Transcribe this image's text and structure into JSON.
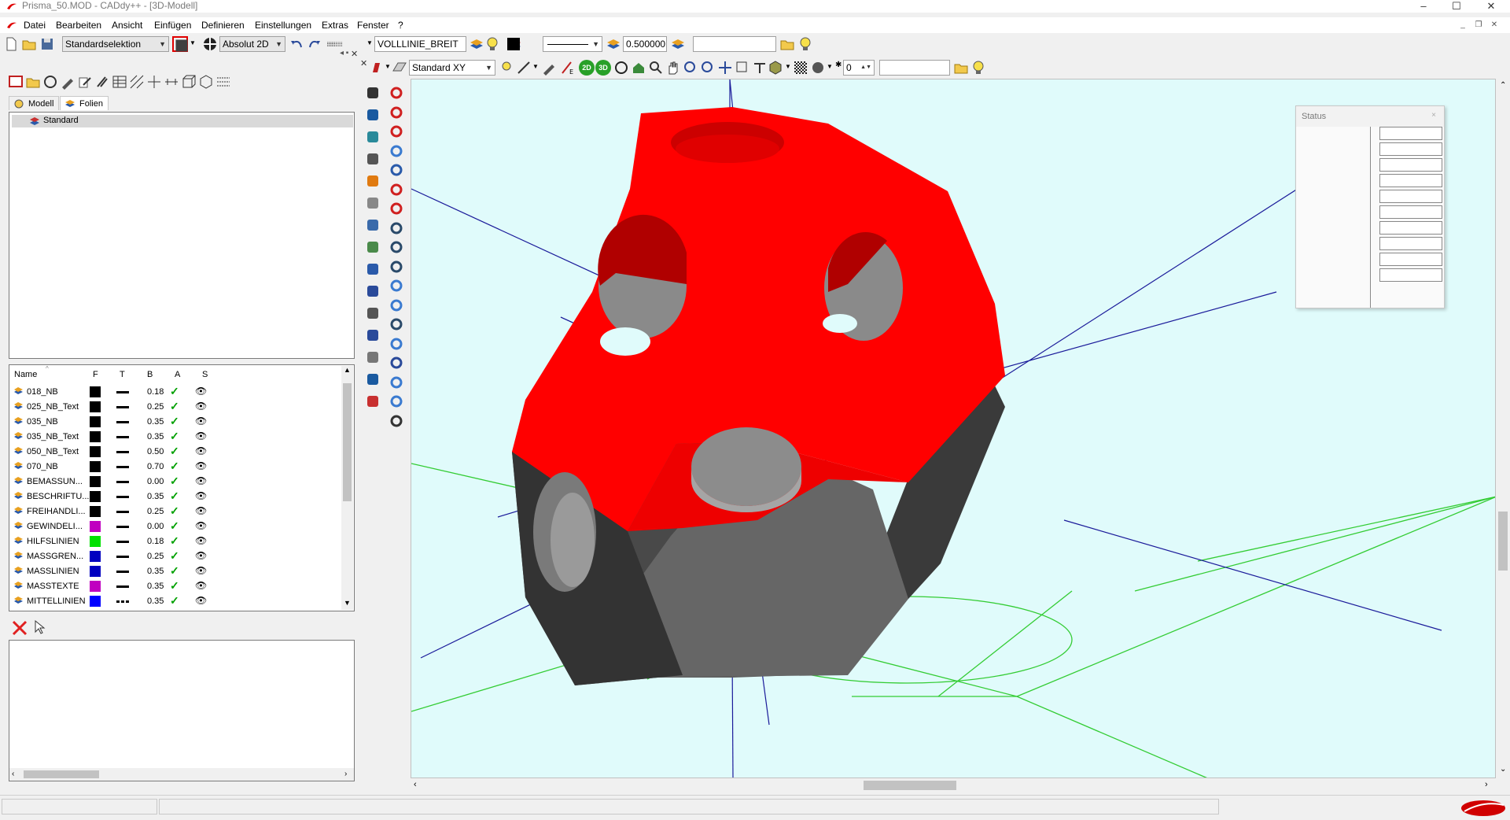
{
  "window": {
    "title": "Prisma_50.MOD  -  CADdy++ - [3D-Modell]",
    "buttons": [
      "–",
      "☐",
      "✕"
    ]
  },
  "menu": {
    "items": [
      "Datei",
      "Bearbeiten",
      "Ansicht",
      "Einfügen",
      "Definieren",
      "Einstellungen",
      "Extras",
      "Fenster",
      "?"
    ],
    "mdi_buttons": [
      "_",
      "❐",
      "✕"
    ]
  },
  "toolbar1": {
    "selection_mode": "Standardselektion",
    "coord_mode": "Absolut 2D",
    "linetype": "VOLLLINIE_BREIT",
    "line_width": "0.500000",
    "text_field": ""
  },
  "toolbar2": {
    "view_plane": "Standard XY",
    "btn_2d": "2D",
    "btn_3d": "3D",
    "number_value": "0",
    "text_field": ""
  },
  "left_panel": {
    "tabs": [
      "Modell",
      "Folien"
    ],
    "active_tab": "Folien",
    "tree_root": "Standard",
    "table": {
      "headers": [
        "Name",
        "F",
        "T",
        "B",
        "A",
        "S"
      ],
      "rows": [
        {
          "name": "018_NB",
          "color": "#000000",
          "width": "0.18",
          "linestyle": "solid"
        },
        {
          "name": "025_NB_Text",
          "color": "#000000",
          "width": "0.25",
          "linestyle": "solid"
        },
        {
          "name": "035_NB",
          "color": "#000000",
          "width": "0.35",
          "linestyle": "solid"
        },
        {
          "name": "035_NB_Text",
          "color": "#000000",
          "width": "0.35",
          "linestyle": "solid"
        },
        {
          "name": "050_NB_Text",
          "color": "#000000",
          "width": "0.50",
          "linestyle": "solid"
        },
        {
          "name": "070_NB",
          "color": "#000000",
          "width": "0.70",
          "linestyle": "solid"
        },
        {
          "name": "BEMASSUN...",
          "color": "#000000",
          "width": "0.00",
          "linestyle": "solid"
        },
        {
          "name": "BESCHRIFTU...",
          "color": "#000000",
          "width": "0.35",
          "linestyle": "solid"
        },
        {
          "name": "FREIHANDLI...",
          "color": "#000000",
          "width": "0.25",
          "linestyle": "solid"
        },
        {
          "name": "GEWINDELI...",
          "color": "#c000c0",
          "width": "0.00",
          "linestyle": "solid"
        },
        {
          "name": "HILFSLINIEN",
          "color": "#00e000",
          "width": "0.18",
          "linestyle": "solid"
        },
        {
          "name": "MASSGREN...",
          "color": "#0000c0",
          "width": "0.25",
          "linestyle": "solid"
        },
        {
          "name": "MASSLINIEN",
          "color": "#0000c0",
          "width": "0.35",
          "linestyle": "solid"
        },
        {
          "name": "MASSTEXTE",
          "color": "#c000c0",
          "width": "0.35",
          "linestyle": "solid"
        },
        {
          "name": "MITTELLINIEN",
          "color": "#0000ff",
          "width": "0.35",
          "linestyle": "dash"
        }
      ]
    }
  },
  "status_panel": {
    "title": "Status",
    "close": "×",
    "cells": [
      "",
      "",
      "",
      "",
      "",
      "",
      "",
      "",
      "",
      ""
    ]
  },
  "colors": {
    "model_red": "#ff0000",
    "model_grey": "#5a5a5a",
    "viewport_bg": "#e0fbfb",
    "axis_blue": "#1a1a9a",
    "grid_green": "#33cc33"
  }
}
